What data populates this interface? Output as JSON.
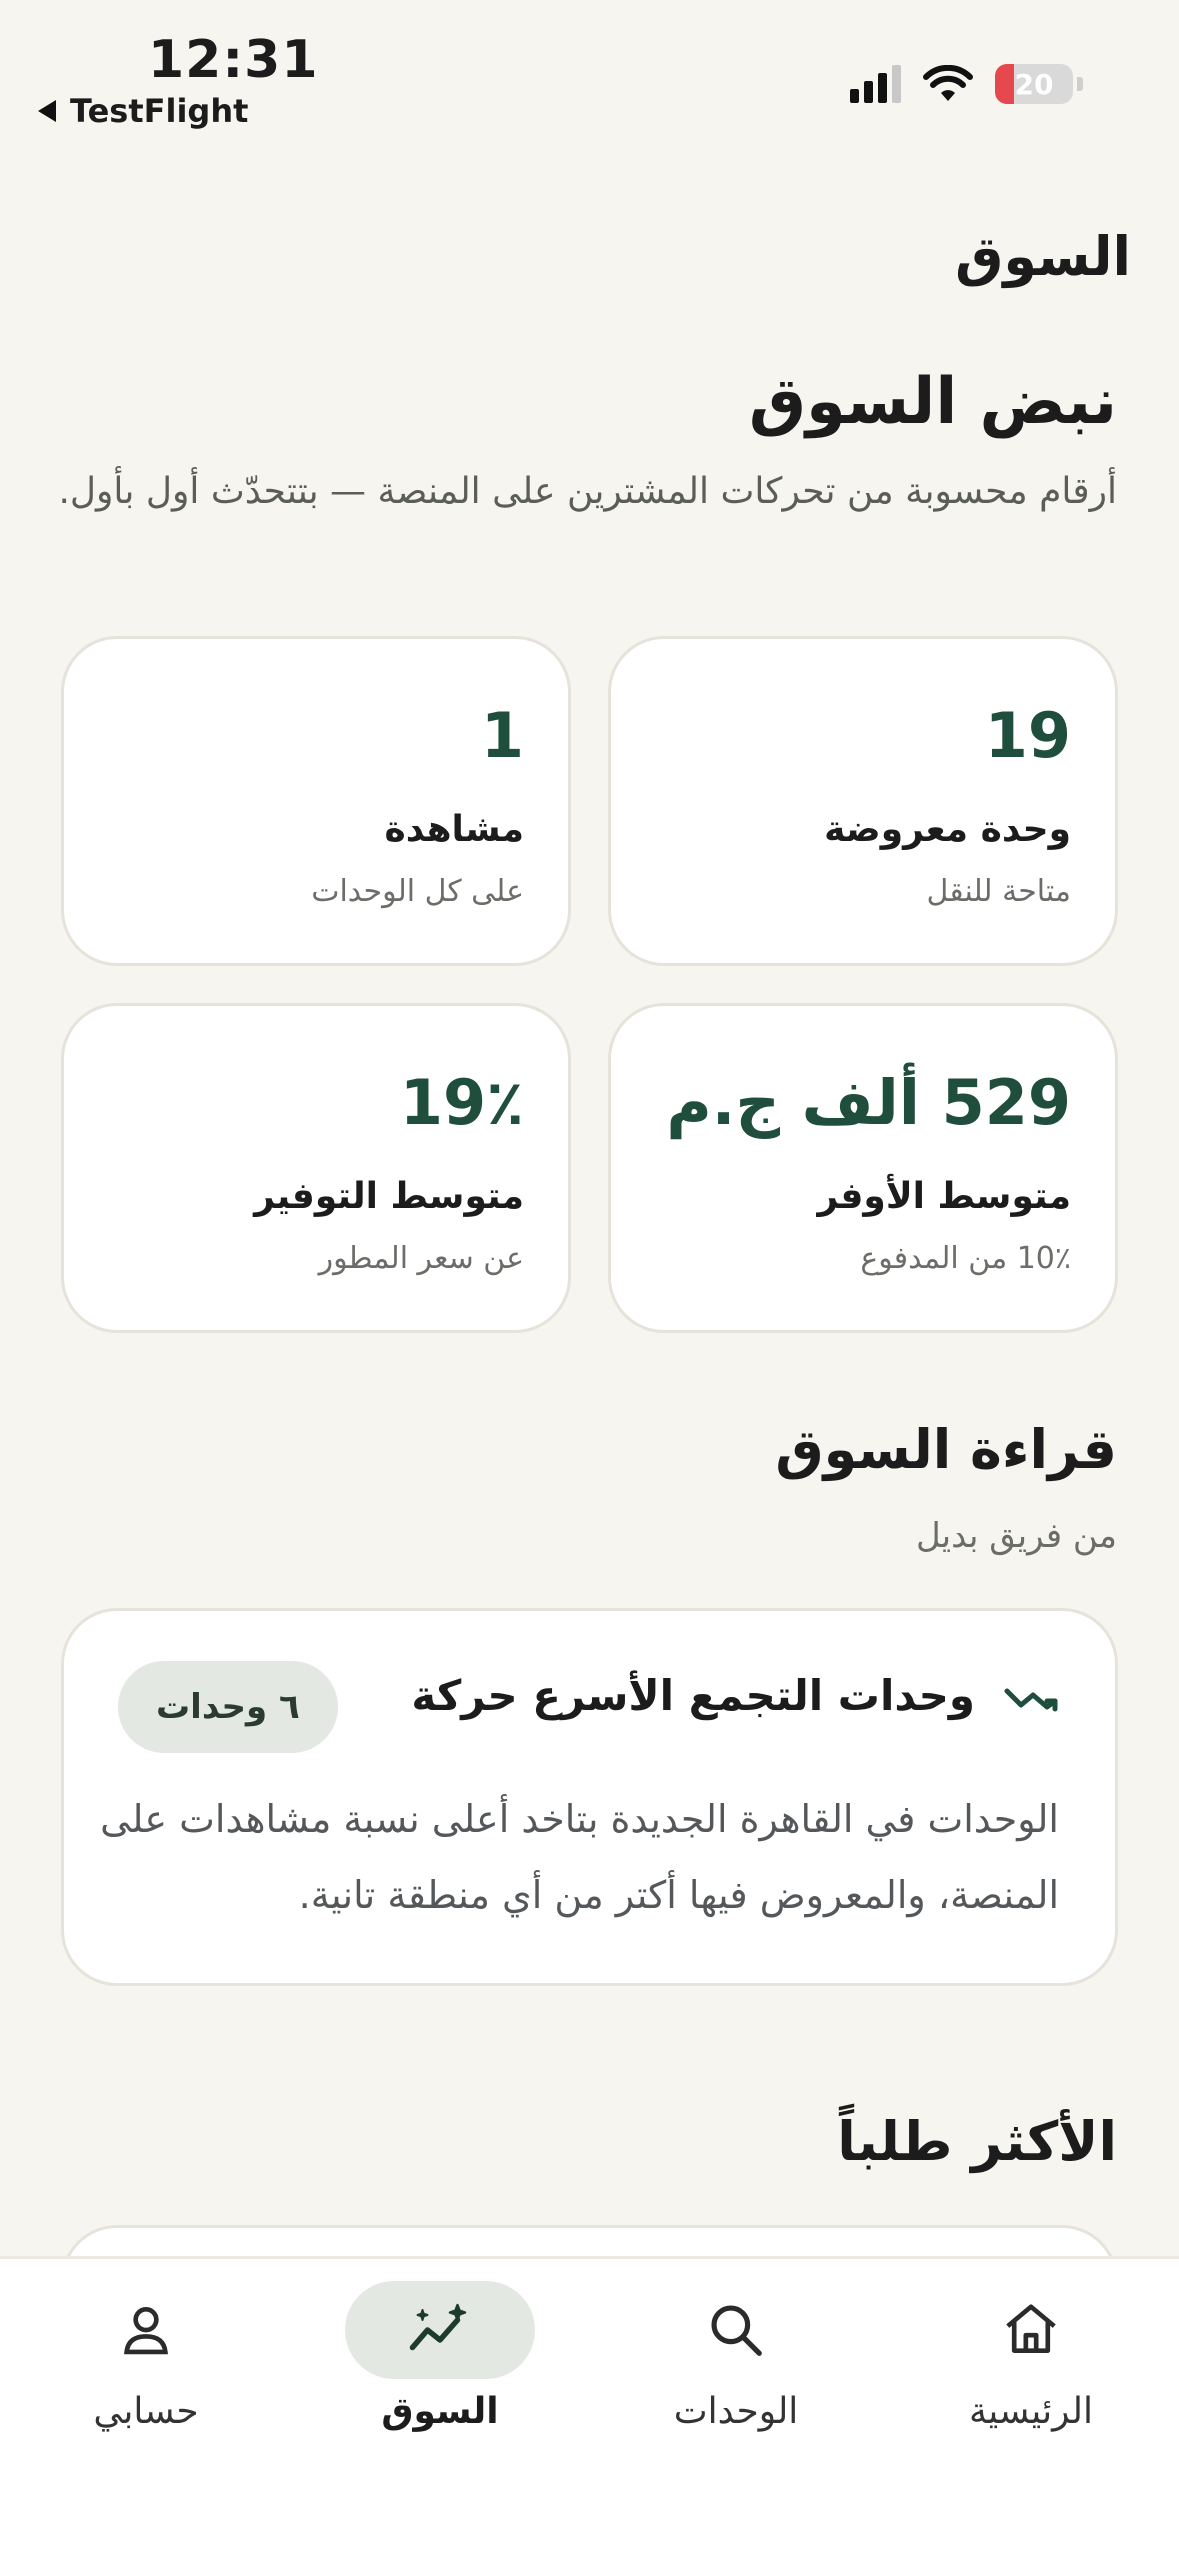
{
  "status_bar": {
    "time": "12:31",
    "back_label": "TestFlight",
    "battery": "20"
  },
  "page": {
    "title": "السوق"
  },
  "pulse": {
    "title": "نبض السوق",
    "description": "أرقام محسوبة من تحركات المشترين على المنصة — بتتحدّث أول بأول.",
    "stats": [
      {
        "value": "19",
        "label": "وحدة معروضة",
        "sub": "متاحة للنقل"
      },
      {
        "value": "1",
        "label": "مشاهدة",
        "sub": "على كل الوحدات"
      },
      {
        "value": "529 ألف ج.م",
        "label": "متوسط الأوفر",
        "sub": "10٪ من المدفوع"
      },
      {
        "value": "19٪",
        "label": "متوسط التوفير",
        "sub": "عن سعر المطور"
      }
    ]
  },
  "market_read": {
    "title": "قراءة السوق",
    "subtitle": "من فريق بديل",
    "insight": {
      "title": "وحدات التجمع الأسرع حركة",
      "badge": "٦ وحدات",
      "body": "الوحدات في القاهرة الجديدة بتاخد أعلى نسبة مشاهدات على المنصة، والمعروض فيها أكتر من أي منطقة تانية.",
      "icon": "trending-icon"
    }
  },
  "most_demanded": {
    "title": "الأكثر طلباً"
  },
  "bottom_nav": {
    "items": [
      {
        "label": "الرئيسية",
        "icon": "home-icon"
      },
      {
        "label": "الوحدات",
        "icon": "search-icon"
      },
      {
        "label": "السوق",
        "icon": "market-trend-icon",
        "active": true
      },
      {
        "label": "حسابي",
        "icon": "user-icon"
      }
    ]
  },
  "colors": {
    "background": "#f6f5f0",
    "accent": "#1f4e3d",
    "active_pill": "#e3e8e3"
  }
}
